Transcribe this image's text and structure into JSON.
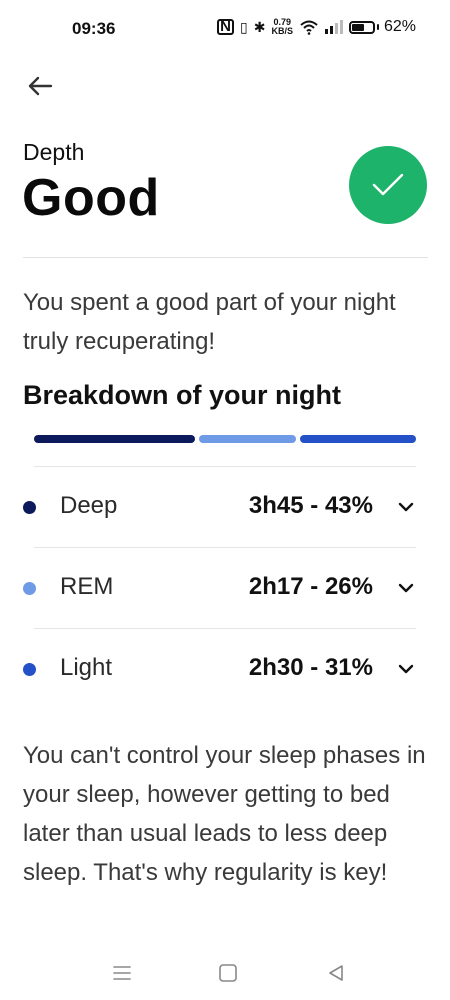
{
  "status_bar": {
    "time": "09:36",
    "nfc": "N",
    "net_speed_value": "0.79",
    "net_speed_unit": "KB/S",
    "battery_percent": "62%",
    "battery_level": 0.62
  },
  "header": {
    "back_icon": "arrow-left-icon"
  },
  "summary": {
    "metric_label": "Depth",
    "quality": "Good",
    "badge_icon": "check-icon",
    "badge_color": "#1db36b"
  },
  "intro": "You spent a good part of your night truly recuperating!",
  "breakdown": {
    "title": "Breakdown of your night",
    "phases": [
      {
        "name": "Deep",
        "value": "3h45 - 43%",
        "fraction": 0.43,
        "color": "#0c1a5c"
      },
      {
        "name": "REM",
        "value": "2h17 - 26%",
        "fraction": 0.26,
        "color": "#6f9ae6"
      },
      {
        "name": "Light",
        "value": "2h30 - 31%",
        "fraction": 0.31,
        "color": "#2450c8"
      }
    ]
  },
  "advice": "You can't control your sleep phases in your sleep, however getting to bed later than usual leads to less deep sleep. That's why regularity is key!",
  "nav_bar": {
    "menu_icon": "menu-icon",
    "home_icon": "square-home-icon",
    "back_icon": "triangle-back-icon"
  }
}
